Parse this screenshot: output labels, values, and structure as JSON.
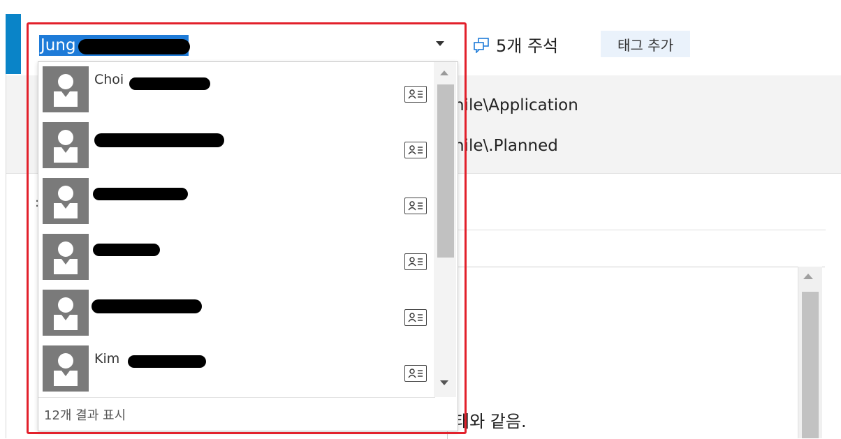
{
  "picker": {
    "selected_text": "Jung",
    "items": [
      {
        "name": "Choi"
      },
      {
        "name": ""
      },
      {
        "name": ""
      },
      {
        "name": ""
      },
      {
        "name": ""
      },
      {
        "name": "Kim"
      }
    ],
    "footer_text": "12개 결과 표시"
  },
  "toolbar": {
    "annotations_label": "5개 주석",
    "add_tag_label": "태그 추가"
  },
  "background": {
    "path_line_1": "nile\\Application",
    "path_line_2": "nile\\.Planned",
    "stray_char": ":",
    "textarea_text": "태와 같음."
  },
  "colors": {
    "selection": "#1e7bd8",
    "highlight_frame": "#e2202b",
    "accent_bar": "#0a84c8"
  },
  "icons": [
    "comment-icon",
    "contact-card-icon",
    "person-avatar-icon",
    "dropdown-arrow-icon"
  ]
}
